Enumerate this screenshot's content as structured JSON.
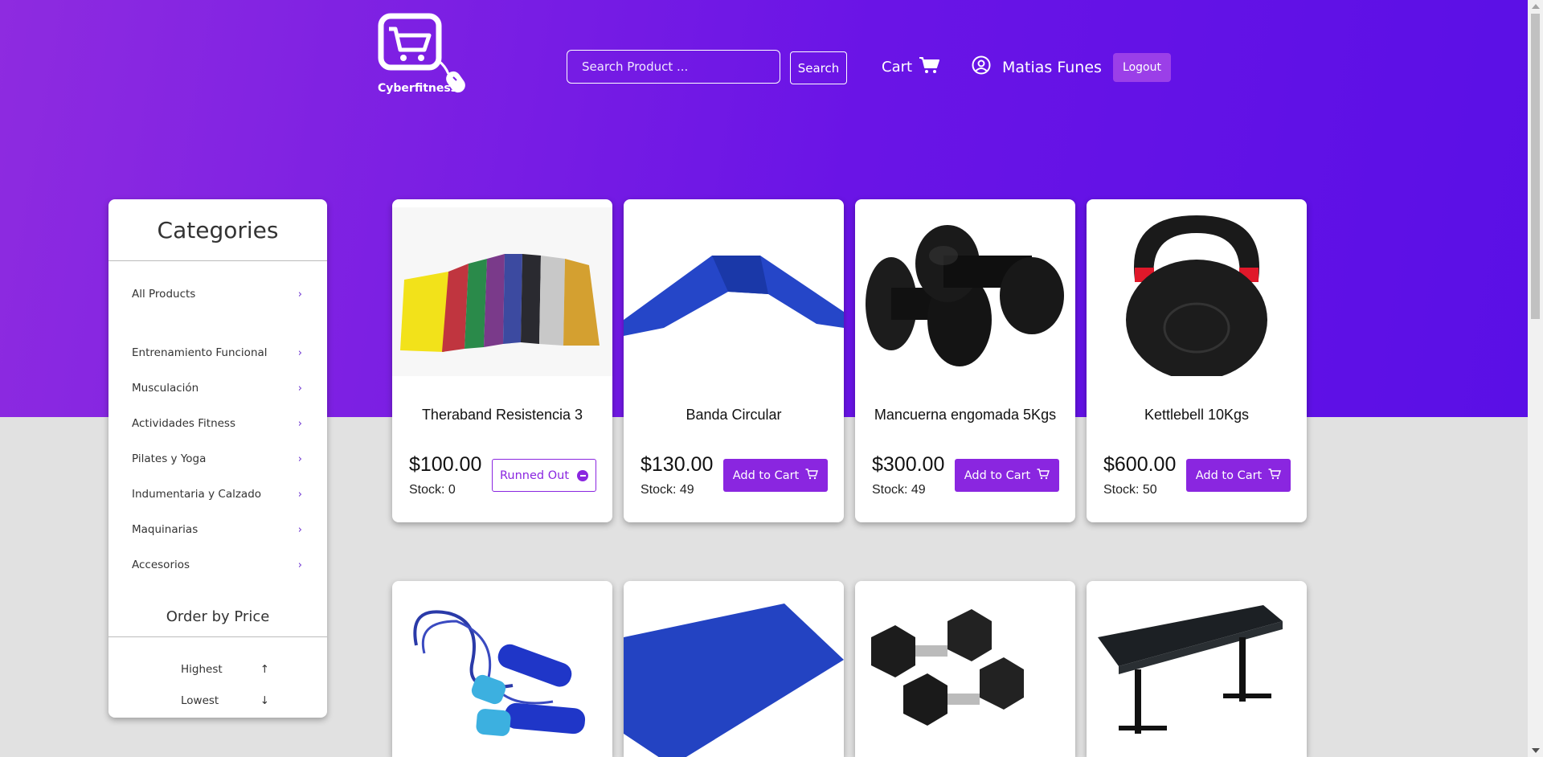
{
  "header": {
    "brand": "Cyberfitness",
    "search_placeholder": "Search Product ...",
    "search_button": "Search",
    "cart_label": "Cart",
    "user_name": "Matias Funes",
    "logout_label": "Logout"
  },
  "sidebar": {
    "title": "Categories",
    "items": [
      {
        "label": "All Products"
      },
      {
        "label": "Entrenamiento Funcional"
      },
      {
        "label": "Musculación"
      },
      {
        "label": "Actividades Fitness"
      },
      {
        "label": "Pilates y Yoga"
      },
      {
        "label": "Indumentaria y Calzado"
      },
      {
        "label": "Maquinarias"
      },
      {
        "label": "Accesorios"
      }
    ],
    "order_title": "Order by Price",
    "order_options": [
      {
        "label": "Highest"
      },
      {
        "label": "Lowest"
      }
    ]
  },
  "products": [
    {
      "name": "Theraband Resistencia 3",
      "price": "$100.00",
      "stock": "Stock: 0",
      "button": "Runned Out"
    },
    {
      "name": "Banda Circular",
      "price": "$130.00",
      "stock": "Stock: 49",
      "button": "Add to Cart"
    },
    {
      "name": "Mancuerna engomada 5Kgs",
      "price": "$300.00",
      "stock": "Stock: 49",
      "button": "Add to Cart"
    },
    {
      "name": "Kettlebell 10Kgs",
      "price": "$600.00",
      "stock": "Stock: 50",
      "button": "Add to Cart"
    },
    {
      "name": "",
      "price": "",
      "stock": "",
      "button": ""
    },
    {
      "name": "",
      "price": "",
      "stock": "",
      "button": ""
    },
    {
      "name": "",
      "price": "",
      "stock": "",
      "button": ""
    },
    {
      "name": "",
      "price": "",
      "stock": "",
      "button": ""
    }
  ],
  "colors": {
    "accent": "#8a26e0",
    "hero_start": "#8e2be0",
    "hero_end": "#5a0fe6",
    "page_bg": "#e1e1e1"
  }
}
